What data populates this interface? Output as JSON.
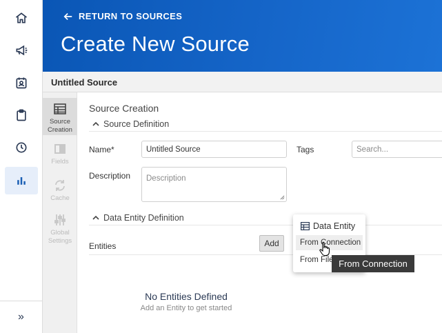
{
  "header": {
    "return_label": "RETURN TO SOURCES",
    "title": "Create New Source"
  },
  "source_bar": {
    "name": "Untitled Source"
  },
  "steps": [
    {
      "label": "Source Creation",
      "icon": "table-icon",
      "active": true
    },
    {
      "label": "Fields",
      "icon": "fields-icon",
      "active": false
    },
    {
      "label": "Cache",
      "icon": "refresh-icon",
      "active": false
    },
    {
      "label": "Global Settings",
      "icon": "sliders-icon",
      "active": false
    }
  ],
  "rail": {
    "items": [
      "home-icon",
      "megaphone-icon",
      "contact-calendar-icon",
      "clipboard-icon",
      "clock-icon",
      "bar-chart-icon"
    ],
    "expand_label": "»"
  },
  "form": {
    "section_title": "Source Creation",
    "source_definition": "Source Definition",
    "name_label": "Name*",
    "name_value": "Untitled Source",
    "tags_label": "Tags",
    "tags_placeholder": "Search...",
    "description_label": "Description",
    "description_placeholder": "Description",
    "data_entity_definition": "Data Entity Definition",
    "entities_label": "Entities",
    "add_label": "Add",
    "empty_title": "No Entities Defined",
    "empty_sub": "Add an Entity to get started"
  },
  "popup": {
    "heading": "Data Entity",
    "items": [
      "From Connection",
      "From File"
    ]
  },
  "tooltip": "From Connection",
  "colors": {
    "header": "#1565c8",
    "rail_active": "#e6eefa",
    "accent": "#1a5fb4"
  }
}
